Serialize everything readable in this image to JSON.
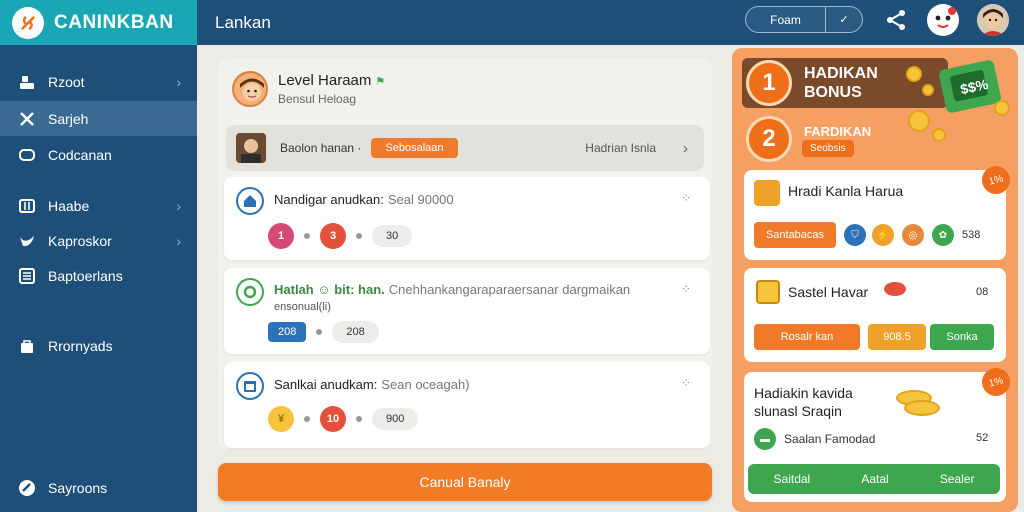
{
  "brand": {
    "name": "CANINKBAN"
  },
  "sidebar": {
    "items": [
      {
        "label": "Rzoot",
        "icon": "user-icon"
      },
      {
        "label": "Sarjeh",
        "icon": "tools-icon"
      },
      {
        "label": "Codcanan",
        "icon": "chat-icon"
      },
      {
        "label": "Haabe",
        "icon": "book-icon"
      },
      {
        "label": "Kaproskor",
        "icon": "bird-icon"
      },
      {
        "label": "Baptoerlans",
        "icon": "list-icon"
      },
      {
        "label": "Rrornyads",
        "icon": "bag-icon"
      },
      {
        "label": "Sayroons",
        "icon": "support-icon"
      }
    ]
  },
  "topbar": {
    "title": "Lankan",
    "select_value": "Foam",
    "select_arrow": "✓"
  },
  "profile": {
    "name": "Level Haraam",
    "flag": "⚑",
    "subtitle": "Bensul Heloag"
  },
  "selector": {
    "label": "Baolon hanan ·",
    "pill": "Sebosalaan",
    "right": "Hadrian Isnla"
  },
  "cards": [
    {
      "title": "Nandigar anudkan:",
      "sub": "Seal 90000",
      "badges": [
        "1",
        "3"
      ],
      "value": "30"
    },
    {
      "title": "Hatlah ☺ bit: han.",
      "sub": "Cnehhankangaraparaersanar dargmaikan",
      "sub2": "ensonual(li)",
      "badge": "208",
      "value": "208"
    },
    {
      "title": "Sanlkai anudkam:",
      "sub": "Sean oceagah)",
      "badges": [
        "¥",
        "10"
      ],
      "value": "900"
    }
  ],
  "main_button": "Canual Banaly",
  "right": {
    "bonus1": {
      "num": "1",
      "title_line1": "HADIKAN",
      "title_line2": "BONUS"
    },
    "bonus2": {
      "num": "2",
      "title": "FARDIKAN",
      "pill": "Seobsis"
    },
    "wallet_label": "$$%",
    "card1": {
      "title": "Hradi Kanla Harua",
      "button": "Santabacas",
      "value": "538",
      "tag": "1%"
    },
    "card2": {
      "title": "Sastel Havar",
      "value": "08",
      "btn1": "Rosalr kan",
      "btn2": "908.5",
      "btn3": "Sonka"
    },
    "card3": {
      "title_line1": "Hadiakin kavida",
      "title_line2": "slunasl Sraqin",
      "row_label": "Saalan Famodad",
      "row_value": "52",
      "tag": "1%",
      "bar": [
        "Saitdal",
        "Aatal",
        "Sealer"
      ]
    }
  }
}
